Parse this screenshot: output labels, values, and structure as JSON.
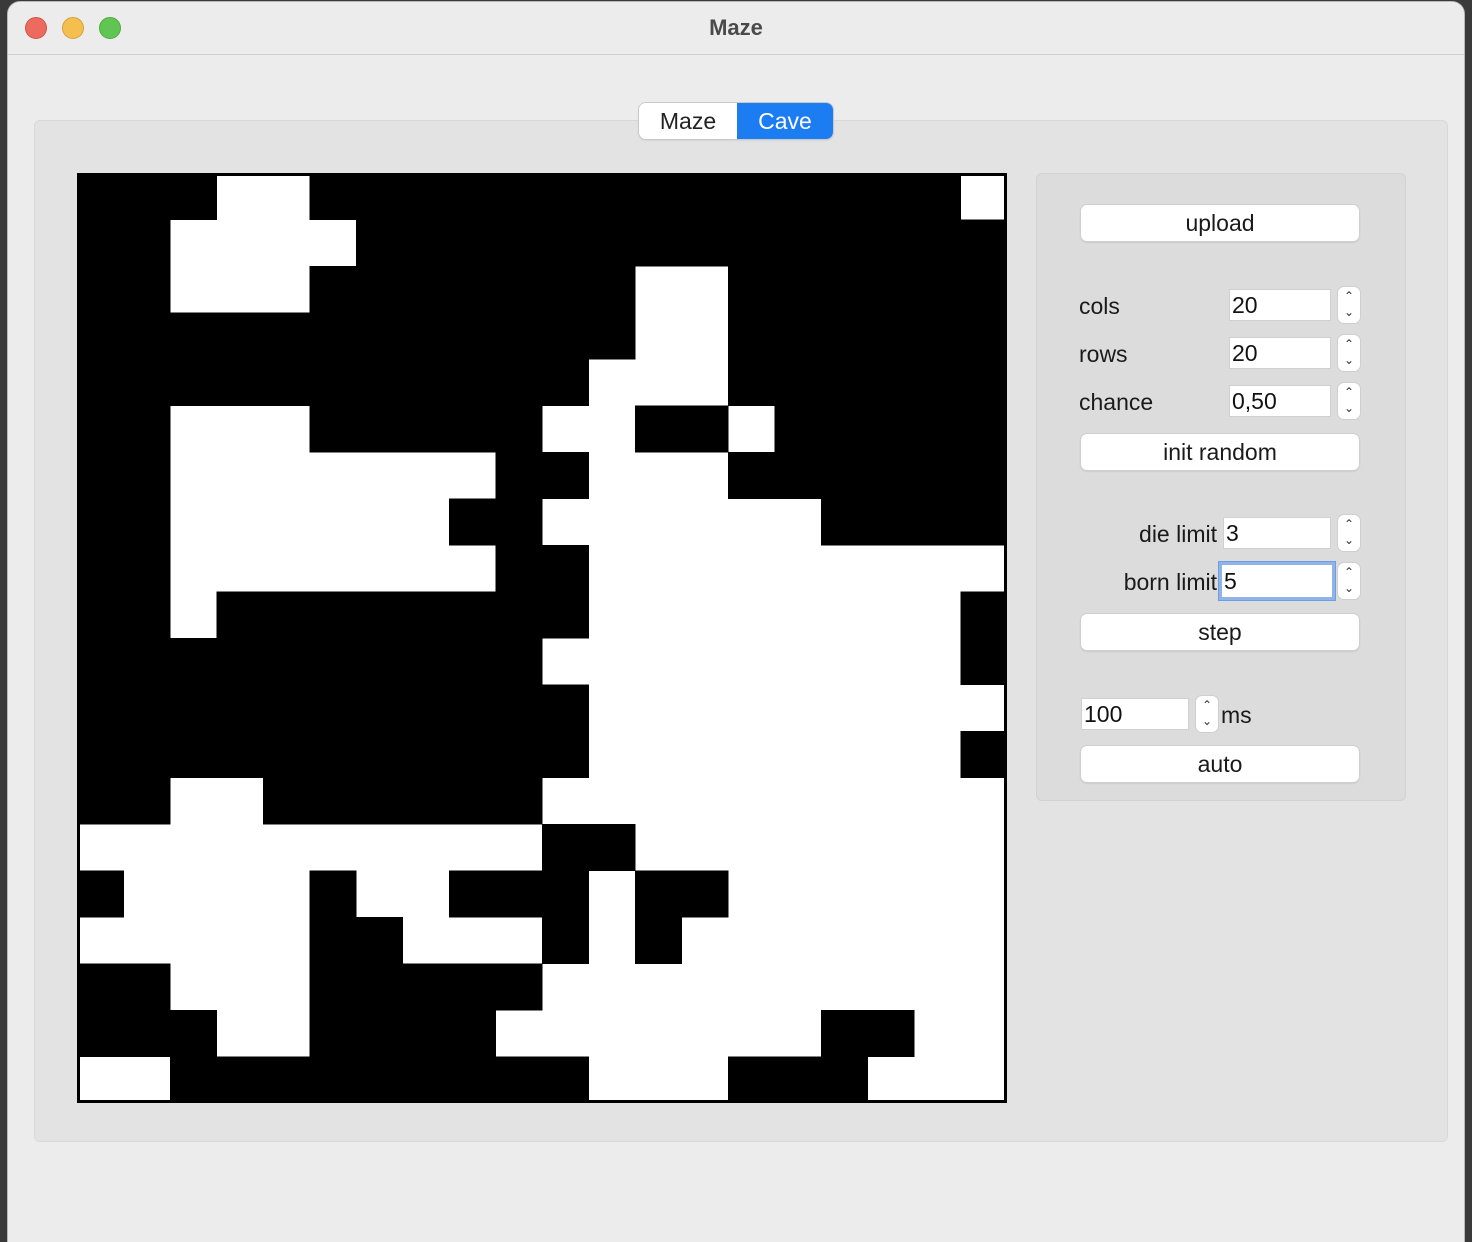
{
  "window": {
    "title": "Maze"
  },
  "tabs": [
    {
      "label": "Maze",
      "selected": false
    },
    {
      "label": "Cave",
      "selected": true
    }
  ],
  "colors": {
    "accent": "#1c7cf2",
    "wall": "#000000",
    "open": "#ffffff"
  },
  "grid": {
    "cols": 20,
    "rows": 20,
    "cells": [
      "...##..............#",
      "..####..............",
      "..###.......##......",
      "............##......",
      "...........###......",
      "..###.....##..#.....",
      "..#######..###......",
      "..######..######....",
      "..#######..#########",
      "..#........########.",
      "..........#########.",
      "...........#########",
      "...........########.",
      "..##......##########",
      "##########..########",
      ".####.##...#..######",
      "#####..###.#.#######",
      "..###.....##########",
      "...##....#######..##",
      "##.........###...###"
    ]
  },
  "controls": {
    "upload": "upload",
    "cols_label": "cols",
    "cols_value": "20",
    "rows_label": "rows",
    "rows_value": "20",
    "chance_label": "chance",
    "chance_value": "0,50",
    "init_random": "init random",
    "die_limit_label": "die limit",
    "die_limit_value": "3",
    "born_limit_label": "born limit",
    "born_limit_value": "5",
    "step": "step",
    "interval_value": "100",
    "interval_unit": "ms",
    "auto": "auto"
  }
}
